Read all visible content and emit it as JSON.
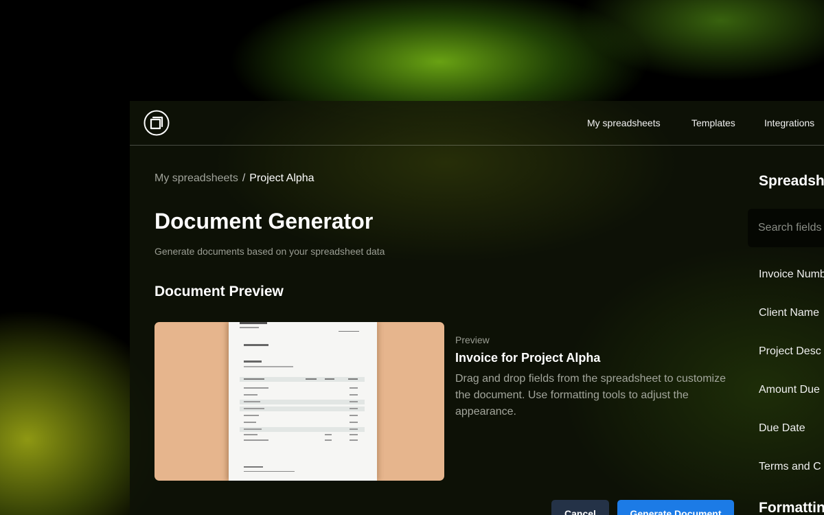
{
  "nav": {
    "items": [
      "My spreadsheets",
      "Templates",
      "Integrations"
    ]
  },
  "breadcrumb": {
    "parent": "My spreadsheets",
    "separator": "/",
    "current": "Project Alpha"
  },
  "page": {
    "title": "Document Generator",
    "subtitle": "Generate documents based on your spreadsheet data"
  },
  "preview_section": {
    "title": "Document Preview",
    "kicker": "Preview",
    "doc_title": "Invoice for Project Alpha",
    "description": "Drag and drop fields from the spreadsheet to customize the document. Use formatting tools to adjust the appearance."
  },
  "actions": {
    "cancel_label": "Cancel",
    "generate_label": "Generate Document"
  },
  "sidebar": {
    "heading": "Spreadsh",
    "search_placeholder": "Search fields",
    "fields": [
      "Invoice Numb",
      "Client Name",
      "Project Desc",
      "Amount Due",
      "Due Date",
      "Terms and C"
    ],
    "heading_2": "Formattin"
  },
  "colors": {
    "primary_button": "#1c7be6",
    "secondary_button": "#243247",
    "preview_background": "#e6b58d"
  },
  "icons": {
    "logo": "app-logo-icon"
  }
}
